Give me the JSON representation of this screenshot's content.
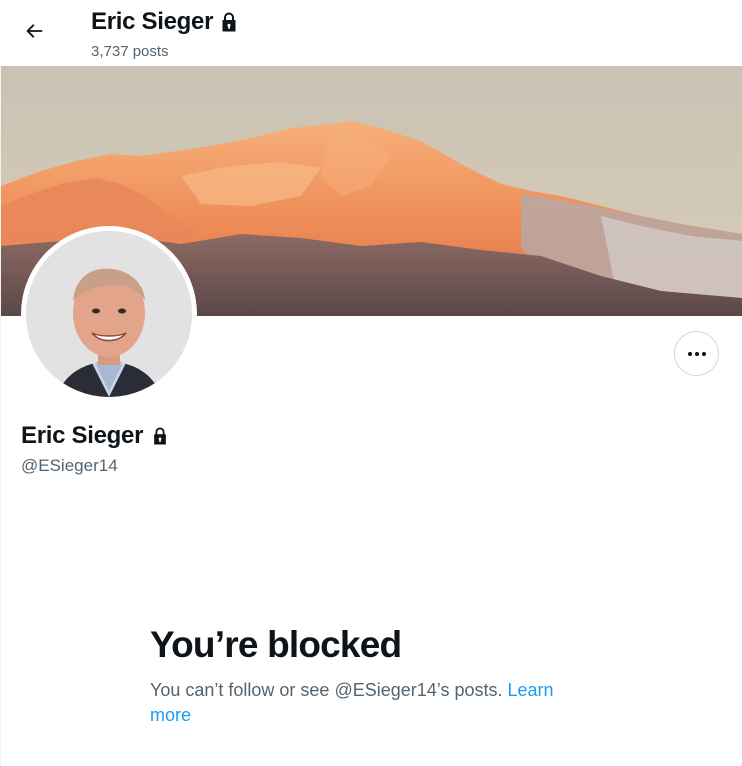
{
  "header": {
    "back_icon": "arrow-left-icon",
    "name": "Eric Sieger",
    "lock_icon": "lock-icon",
    "post_count": "3,737 posts"
  },
  "banner": {
    "description_icon": "mountain-banner-image"
  },
  "profile": {
    "name": "Eric Sieger",
    "lock_icon": "lock-icon",
    "handle": "@ESieger14",
    "more_icon": "more-horizontal-icon"
  },
  "blocked": {
    "title": "You’re blocked",
    "message": "You can’t follow or see @ESieger14’s posts. ",
    "link_label": "Learn more"
  },
  "colors": {
    "text_primary": "#0f1419",
    "text_secondary": "#536471",
    "link": "#1d9bf0",
    "border": "#cfd9de"
  }
}
